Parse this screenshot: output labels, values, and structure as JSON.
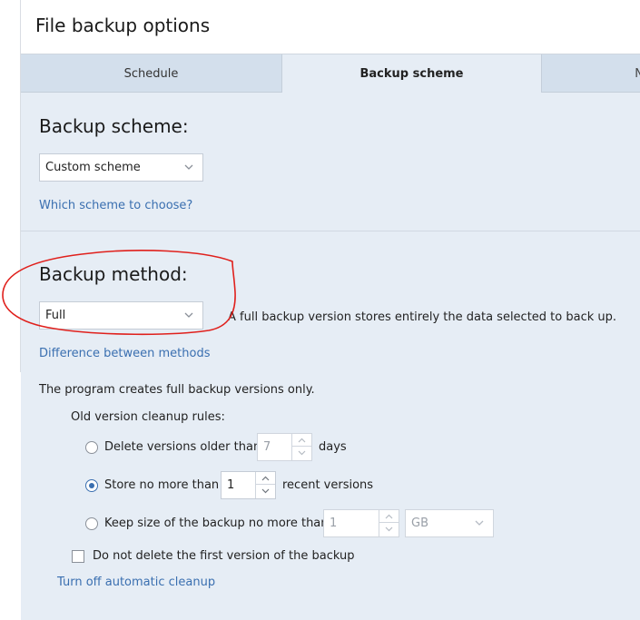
{
  "window": {
    "title": "File backup options"
  },
  "tabs": [
    {
      "label": "Schedule"
    },
    {
      "label": "Backup scheme"
    },
    {
      "label": "N"
    }
  ],
  "scheme": {
    "heading": "Backup scheme:",
    "selected": "Custom scheme",
    "help_link": "Which scheme to choose?"
  },
  "method": {
    "heading": "Backup method:",
    "selected": "Full",
    "description": "A full backup version stores entirely the data selected to back up.",
    "help_link": "Difference between methods"
  },
  "info": {
    "text": "The program creates full backup versions only."
  },
  "cleanup": {
    "heading": "Old version cleanup rules:",
    "rule_older": {
      "label": "Delete versions older than",
      "value": "7",
      "unit": "days",
      "checked": false
    },
    "rule_count": {
      "label": "Store no more than",
      "value": "1",
      "unit": "recent versions",
      "checked": true
    },
    "rule_size": {
      "label": "Keep size of the backup no more than",
      "value": "1",
      "unit": "GB",
      "checked": false
    },
    "keep_first": {
      "label": "Do not delete the first version of the backup",
      "checked": false
    },
    "turn_off_link": "Turn off automatic cleanup"
  },
  "colors": {
    "link": "#3a6fb0",
    "panel": "#e6edf5",
    "tabbar": "#d3dfec",
    "annotation": "#e0201c"
  }
}
